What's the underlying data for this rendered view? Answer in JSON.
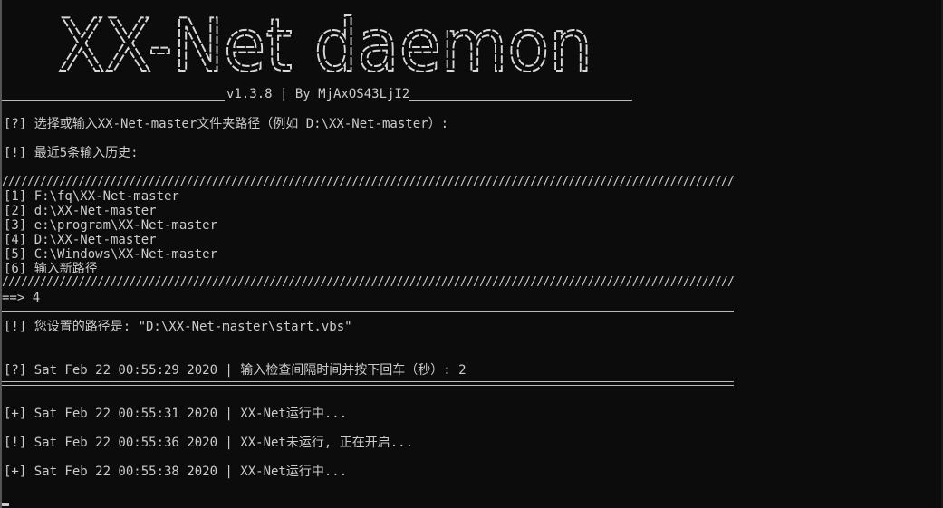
{
  "window": {
    "banner_text": "XX-Net daemon",
    "version_line": "v1.3.8 | By MjAxOS43LjI2"
  },
  "prompts": {
    "select_path": "[?] 选择或输入XX-Net-master文件夹路径（例如 D:\\XX-Net-master）:",
    "history_title": "[!] 最近5条输入历史:"
  },
  "history": [
    "[1] F:\\fq\\XX-Net-master",
    "[2] d:\\XX-Net-master",
    "[3] e:\\program\\XX-Net-master",
    "[4] D:\\XX-Net-master",
    "[5] C:\\Windows\\XX-Net-master",
    "[6] 输入新路径"
  ],
  "input_line": "==> 4",
  "path_set": "[!] 您设置的路径是: \"D:\\XX-Net-master\\start.vbs\"",
  "interval_prompt": "[?] Sat Feb 22 00:55:29 2020 | 输入检查间隔时间并按下回车（秒）: 2",
  "log": [
    "[+] Sat Feb 22 00:55:31 2020 | XX-Net运行中...",
    "[!] Sat Feb 22 00:55:36 2020 | XX-Net未运行, 正在开启...",
    "[+] Sat Feb 22 00:55:38 2020 | XX-Net运行中..."
  ],
  "slash_row": "//////////////////////////////////////////////////////////////////////////////////////////////////////////////////////////////////////////////////////////////"
}
